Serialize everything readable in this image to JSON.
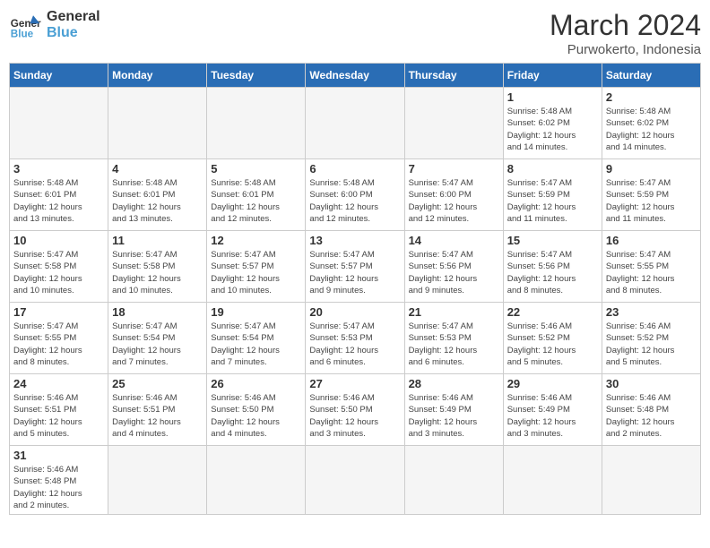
{
  "header": {
    "logo_general": "General",
    "logo_blue": "Blue",
    "month": "March 2024",
    "location": "Purwokerto, Indonesia"
  },
  "days_of_week": [
    "Sunday",
    "Monday",
    "Tuesday",
    "Wednesday",
    "Thursday",
    "Friday",
    "Saturday"
  ],
  "weeks": [
    [
      {
        "day": "",
        "info": ""
      },
      {
        "day": "",
        "info": ""
      },
      {
        "day": "",
        "info": ""
      },
      {
        "day": "",
        "info": ""
      },
      {
        "day": "",
        "info": ""
      },
      {
        "day": "1",
        "info": "Sunrise: 5:48 AM\nSunset: 6:02 PM\nDaylight: 12 hours\nand 14 minutes."
      },
      {
        "day": "2",
        "info": "Sunrise: 5:48 AM\nSunset: 6:02 PM\nDaylight: 12 hours\nand 14 minutes."
      }
    ],
    [
      {
        "day": "3",
        "info": "Sunrise: 5:48 AM\nSunset: 6:01 PM\nDaylight: 12 hours\nand 13 minutes."
      },
      {
        "day": "4",
        "info": "Sunrise: 5:48 AM\nSunset: 6:01 PM\nDaylight: 12 hours\nand 13 minutes."
      },
      {
        "day": "5",
        "info": "Sunrise: 5:48 AM\nSunset: 6:01 PM\nDaylight: 12 hours\nand 12 minutes."
      },
      {
        "day": "6",
        "info": "Sunrise: 5:48 AM\nSunset: 6:00 PM\nDaylight: 12 hours\nand 12 minutes."
      },
      {
        "day": "7",
        "info": "Sunrise: 5:47 AM\nSunset: 6:00 PM\nDaylight: 12 hours\nand 12 minutes."
      },
      {
        "day": "8",
        "info": "Sunrise: 5:47 AM\nSunset: 5:59 PM\nDaylight: 12 hours\nand 11 minutes."
      },
      {
        "day": "9",
        "info": "Sunrise: 5:47 AM\nSunset: 5:59 PM\nDaylight: 12 hours\nand 11 minutes."
      }
    ],
    [
      {
        "day": "10",
        "info": "Sunrise: 5:47 AM\nSunset: 5:58 PM\nDaylight: 12 hours\nand 10 minutes."
      },
      {
        "day": "11",
        "info": "Sunrise: 5:47 AM\nSunset: 5:58 PM\nDaylight: 12 hours\nand 10 minutes."
      },
      {
        "day": "12",
        "info": "Sunrise: 5:47 AM\nSunset: 5:57 PM\nDaylight: 12 hours\nand 10 minutes."
      },
      {
        "day": "13",
        "info": "Sunrise: 5:47 AM\nSunset: 5:57 PM\nDaylight: 12 hours\nand 9 minutes."
      },
      {
        "day": "14",
        "info": "Sunrise: 5:47 AM\nSunset: 5:56 PM\nDaylight: 12 hours\nand 9 minutes."
      },
      {
        "day": "15",
        "info": "Sunrise: 5:47 AM\nSunset: 5:56 PM\nDaylight: 12 hours\nand 8 minutes."
      },
      {
        "day": "16",
        "info": "Sunrise: 5:47 AM\nSunset: 5:55 PM\nDaylight: 12 hours\nand 8 minutes."
      }
    ],
    [
      {
        "day": "17",
        "info": "Sunrise: 5:47 AM\nSunset: 5:55 PM\nDaylight: 12 hours\nand 8 minutes."
      },
      {
        "day": "18",
        "info": "Sunrise: 5:47 AM\nSunset: 5:54 PM\nDaylight: 12 hours\nand 7 minutes."
      },
      {
        "day": "19",
        "info": "Sunrise: 5:47 AM\nSunset: 5:54 PM\nDaylight: 12 hours\nand 7 minutes."
      },
      {
        "day": "20",
        "info": "Sunrise: 5:47 AM\nSunset: 5:53 PM\nDaylight: 12 hours\nand 6 minutes."
      },
      {
        "day": "21",
        "info": "Sunrise: 5:47 AM\nSunset: 5:53 PM\nDaylight: 12 hours\nand 6 minutes."
      },
      {
        "day": "22",
        "info": "Sunrise: 5:46 AM\nSunset: 5:52 PM\nDaylight: 12 hours\nand 5 minutes."
      },
      {
        "day": "23",
        "info": "Sunrise: 5:46 AM\nSunset: 5:52 PM\nDaylight: 12 hours\nand 5 minutes."
      }
    ],
    [
      {
        "day": "24",
        "info": "Sunrise: 5:46 AM\nSunset: 5:51 PM\nDaylight: 12 hours\nand 5 minutes."
      },
      {
        "day": "25",
        "info": "Sunrise: 5:46 AM\nSunset: 5:51 PM\nDaylight: 12 hours\nand 4 minutes."
      },
      {
        "day": "26",
        "info": "Sunrise: 5:46 AM\nSunset: 5:50 PM\nDaylight: 12 hours\nand 4 minutes."
      },
      {
        "day": "27",
        "info": "Sunrise: 5:46 AM\nSunset: 5:50 PM\nDaylight: 12 hours\nand 3 minutes."
      },
      {
        "day": "28",
        "info": "Sunrise: 5:46 AM\nSunset: 5:49 PM\nDaylight: 12 hours\nand 3 minutes."
      },
      {
        "day": "29",
        "info": "Sunrise: 5:46 AM\nSunset: 5:49 PM\nDaylight: 12 hours\nand 3 minutes."
      },
      {
        "day": "30",
        "info": "Sunrise: 5:46 AM\nSunset: 5:48 PM\nDaylight: 12 hours\nand 2 minutes."
      }
    ],
    [
      {
        "day": "31",
        "info": "Sunrise: 5:46 AM\nSunset: 5:48 PM\nDaylight: 12 hours\nand 2 minutes."
      },
      {
        "day": "",
        "info": ""
      },
      {
        "day": "",
        "info": ""
      },
      {
        "day": "",
        "info": ""
      },
      {
        "day": "",
        "info": ""
      },
      {
        "day": "",
        "info": ""
      },
      {
        "day": "",
        "info": ""
      }
    ]
  ]
}
